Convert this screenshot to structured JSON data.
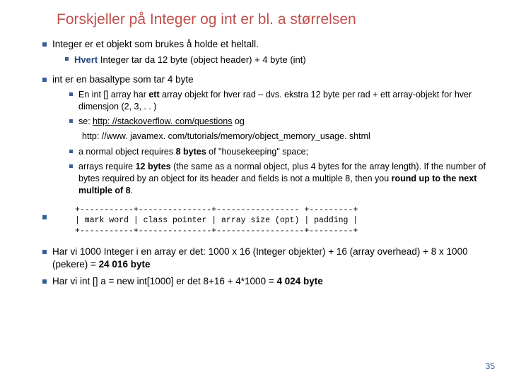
{
  "heading": "Forskjeller på Integer og int  er  bl. a størrelsen",
  "p1_a": "Integer er et objekt som brukes å holde et heltall.",
  "p1_sub_prefix": "Hvert",
  "p1_sub_rest": " Integer tar da 12 byte (object header) + 4 byte (int)",
  "p2_a": "int er en basaltype som tar 4 byte",
  "p2_sub1_a": "En int [] array har ",
  "p2_sub1_b": "ett",
  "p2_sub1_c": " array objekt for hver rad – dvs. ekstra 12 byte per rad + ett array-objekt for hver dimensjon (2, 3, . . )",
  "p2_sub2_a": "se: ",
  "p2_sub2_link": "http: //stackoverflow. com/questions",
  "p2_sub2_b": "  og",
  "p2_url2": "http: //www. javamex. com/tutorials/memory/object_memory_usage. shtml",
  "p2_sub3_a": "a normal object requires ",
  "p2_sub3_b": "8 bytes",
  "p2_sub3_c": " of \"housekeeping\" space;",
  "p2_sub4_a": "arrays require ",
  "p2_sub4_b": "12 bytes",
  "p2_sub4_c": " (the same as a normal object, plus 4 bytes for the array length). If the number of bytes required by an object for its header and fields is not a multiple 8, then you ",
  "p2_sub4_d": "round up to the next multiple of 8",
  "p2_sub4_e": ".",
  "ascii": "+-----------+---------------+----------------- +---------+\n| mark word | class pointer | array size (opt) | padding |\n+-----------+---------------+------------------+---------+",
  "p4_a": "Har vi 1000 Integer i en array er det: 1000 x 16 (Integer objekter)  + 16 (array overhead) + 8 x 1000 (pekere) = ",
  "p4_b": "24 016 byte",
  "p5_a": "Har vi int [] a = new int[1000] er det 8+16 + 4*1000 = ",
  "p5_b": "4 024 byte",
  "pagenum": "35"
}
